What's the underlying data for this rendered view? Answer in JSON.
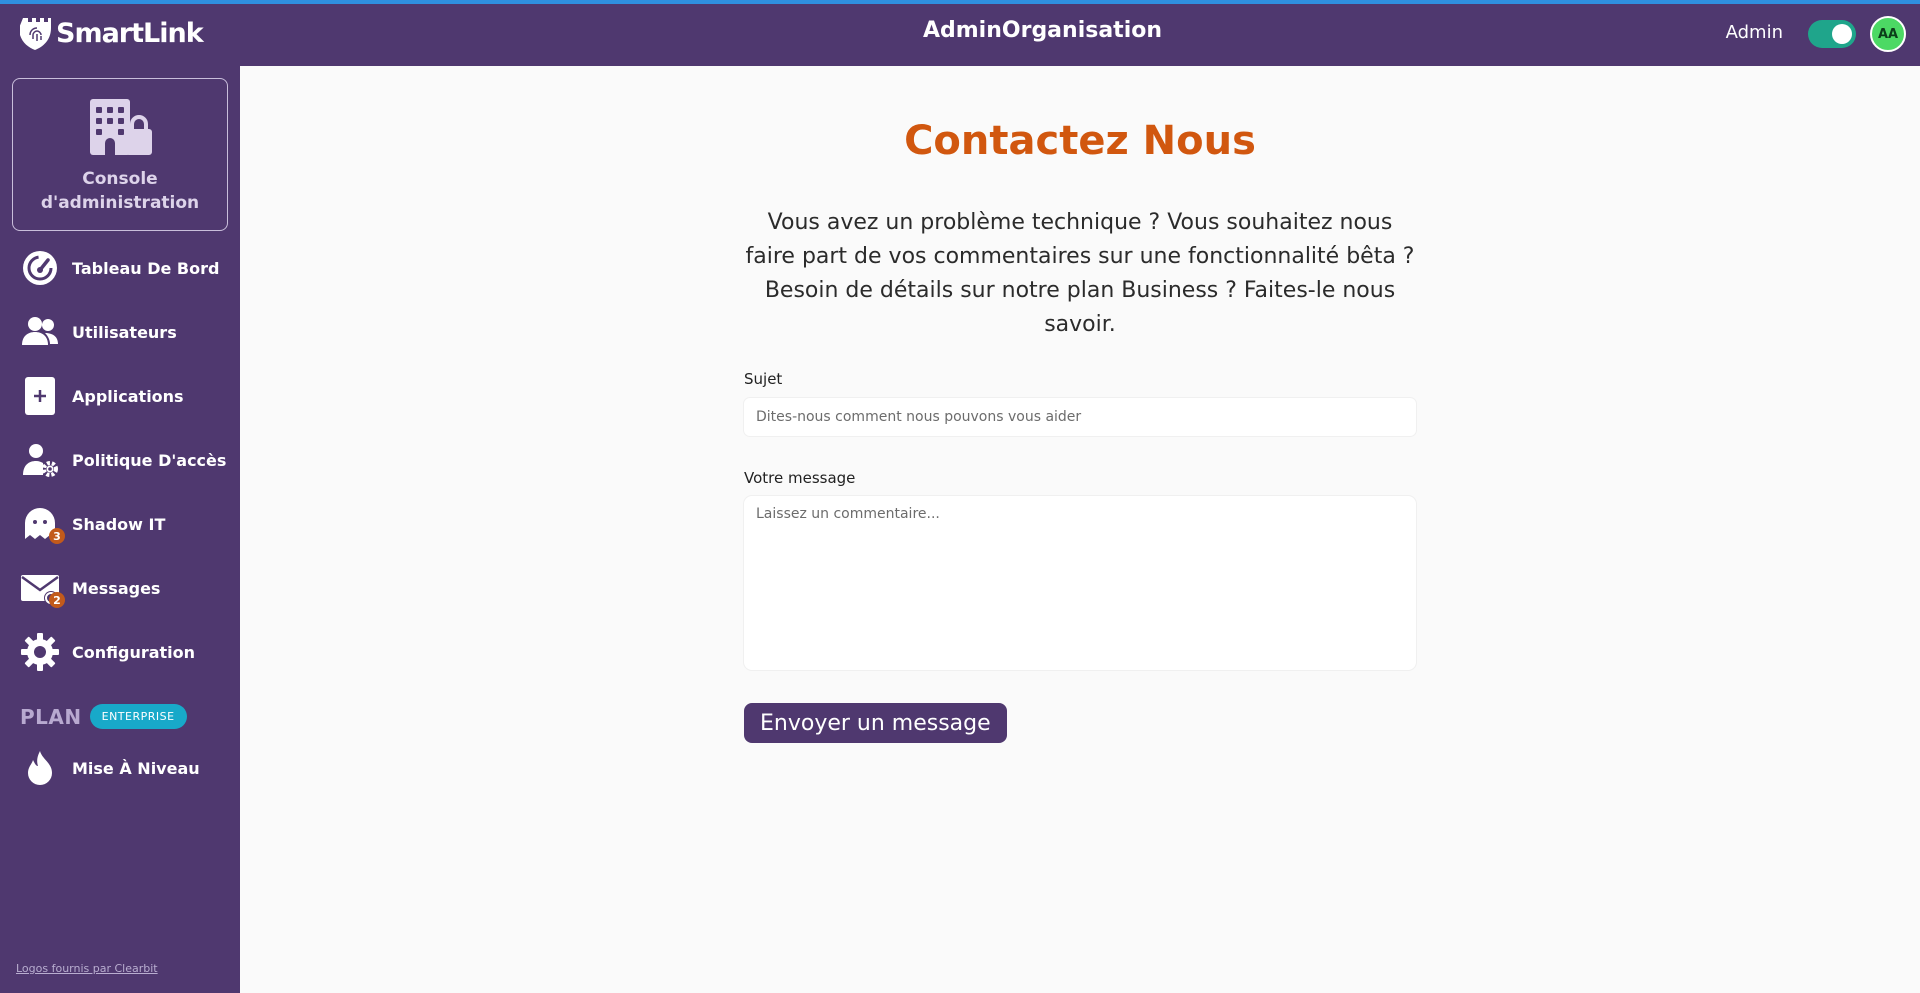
{
  "app": {
    "name": "SmartLink",
    "title": "AdminOrganisation"
  },
  "header": {
    "role": "Admin",
    "avatar_initials": "AA",
    "admin_toggle_on": true
  },
  "sidebar": {
    "console_label": "Console d'administration",
    "items": [
      {
        "label": "Tableau De Bord",
        "icon": "dashboard-gauge-icon"
      },
      {
        "label": "Utilisateurs",
        "icon": "users-icon"
      },
      {
        "label": "Applications",
        "icon": "plus-square-icon"
      },
      {
        "label": "Politique D'accès",
        "icon": "user-gear-icon"
      },
      {
        "label": "Shadow IT",
        "icon": "ghost-icon",
        "badge": "3"
      },
      {
        "label": "Messages",
        "icon": "envelope-icon",
        "badge": "2"
      },
      {
        "label": "Configuration",
        "icon": "gear-icon"
      }
    ],
    "plan_label": "PLAN",
    "plan_badge": "ENTERPRISE",
    "upgrade_label": "Mise À Niveau",
    "footer_link": "Logos fournis par Clearbit"
  },
  "main": {
    "title": "Contactez Nous",
    "intro": "Vous avez un problème technique ? Vous souhaitez nous faire part de vos commentaires sur une fonctionnalité bêta ? Besoin de détails sur notre plan Business ? Faites-le nous savoir.",
    "subject_label": "Sujet",
    "subject_placeholder": "Dites-nous comment nous pouvons vous aider",
    "message_label": "Votre message",
    "message_placeholder": "Laissez un commentaire...",
    "send_label": "Envoyer un message"
  },
  "colors": {
    "primary": "#4f386f",
    "accent": "#d1570f",
    "toggle": "#1fa58b",
    "plan_badge": "#18a9c9"
  }
}
